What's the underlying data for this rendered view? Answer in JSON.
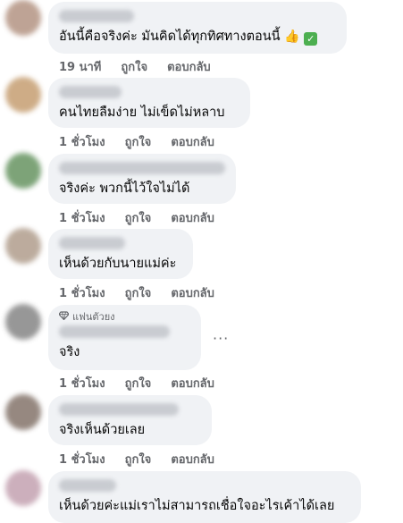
{
  "comments": [
    {
      "text": "อันนี้คือจริงค่ะ มันคิดได้ทุกทิศทางตอนนี้",
      "time": "19 นาที",
      "like": "ถูกใจ",
      "reply": "ตอบกลับ",
      "emoji": "👍",
      "check": "✓",
      "avatar_color": "#b89a8a"
    },
    {
      "text": "คนไทยลืมง่าย ไม่เข็ดไม่หลาบ",
      "time": "1 ชั่วโมง",
      "like": "ถูกใจ",
      "reply": "ตอบกลับ",
      "avatar_color": "#c9a47a"
    },
    {
      "text": "จริงค่ะ พวกนี้ไว้ใจไม่ได้",
      "time": "1 ชั่วโมง",
      "like": "ถูกใจ",
      "reply": "ตอบกลับ",
      "avatar_color": "#6f9a6a"
    },
    {
      "text": "เห็นด้วยกับนายแม่ค่ะ",
      "time": "1 ชั่วโมง",
      "like": "ถูกใจ",
      "reply": "ตอบกลับ",
      "avatar_color": "#b5a393"
    },
    {
      "badge": "แฟนตัวยง",
      "text": "จริง",
      "time": "1 ชั่วโมง",
      "like": "ถูกใจ",
      "reply": "ตอบกลับ",
      "more": "···",
      "avatar_color": "#8c8c8c"
    },
    {
      "text": "จริงเห็นด้วยเลย",
      "time": "1 ชั่วโมง",
      "like": "ถูกใจ",
      "reply": "ตอบกลับ",
      "avatar_color": "#8b7c73"
    },
    {
      "text": "เห็นด้วยค่ะแม่เราไม่สามารถเชื่อใจอะไรเค้าได้เลย",
      "avatar_color": "#c7a7b5"
    }
  ]
}
